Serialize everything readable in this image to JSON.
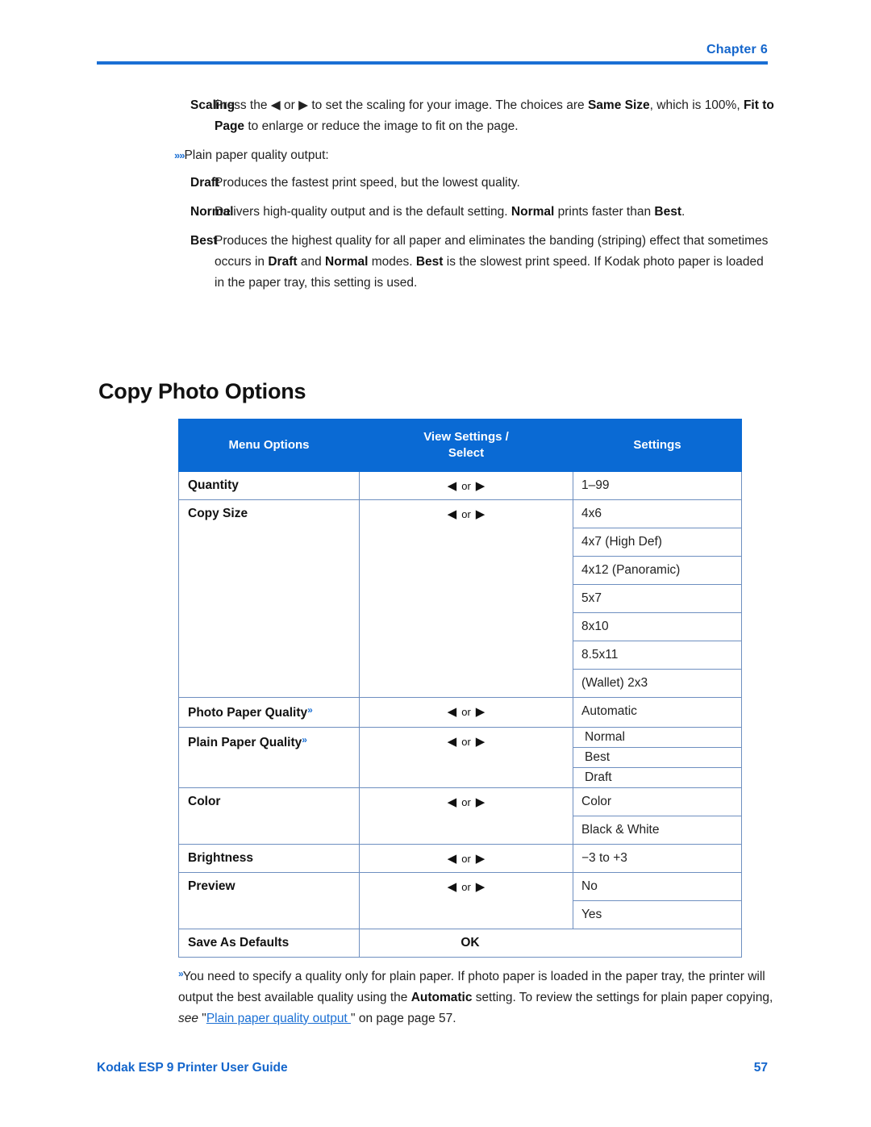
{
  "header": {
    "chapter_label": "Chapter",
    "chapter_number": "6"
  },
  "definitions": [
    {
      "term": "Scaling",
      "desc_parts": [
        {
          "t": "Press the ",
          "b": false
        },
        {
          "t": "◀",
          "b": false
        },
        {
          "t": " or ",
          "b": false
        },
        {
          "t": "▶",
          "b": false
        },
        {
          "t": " to set the scaling for your image. The choices are ",
          "b": false
        },
        {
          "t": "Same Size",
          "b": true
        },
        {
          "t": ", which is 100%, ",
          "b": false
        },
        {
          "t": "Fit to Page",
          "b": true
        },
        {
          "t": " to enlarge or reduce the image to fit on the page.",
          "b": false
        }
      ]
    }
  ],
  "bullet": {
    "marker": "»»",
    "text": "Plain paper quality output:"
  },
  "quality_defs": [
    {
      "term": "Draft",
      "desc_parts": [
        {
          "t": "Produces the fastest print speed, but the lowest quality.",
          "b": false
        }
      ]
    },
    {
      "term": "Normal",
      "desc_parts": [
        {
          "t": "Delivers high-quality output and is the default setting. ",
          "b": false
        },
        {
          "t": "Normal",
          "b": true
        },
        {
          "t": " prints faster than ",
          "b": false
        },
        {
          "t": "Best",
          "b": true
        },
        {
          "t": ".",
          "b": false
        }
      ]
    },
    {
      "term": "Best",
      "desc_parts": [
        {
          "t": "Produces the highest quality for all paper and eliminates the banding (striping) effect that sometimes occurs in ",
          "b": false
        },
        {
          "t": "Draft",
          "b": true
        },
        {
          "t": " and ",
          "b": false
        },
        {
          "t": "Normal",
          "b": true
        },
        {
          "t": " modes. ",
          "b": false
        },
        {
          "t": "Best",
          "b": true
        },
        {
          "t": " is the slowest print speed. If Kodak photo paper is loaded in the paper tray, this setting is used.",
          "b": false
        }
      ]
    }
  ],
  "section": {
    "heading": "Copy Photo Options"
  },
  "table": {
    "columns": [
      "Menu Options",
      "View Settings /\nSelect",
      "Settings"
    ],
    "column_headers": {
      "col1": "Menu Options",
      "col2_line1": "View Settings /",
      "col2_line2": "Select",
      "col3": "Settings"
    },
    "arrow_left": "◀",
    "arrow_right": "▶",
    "or_word": "or",
    "rows": [
      {
        "menu": "Quantity",
        "marker": "",
        "select": "arrows",
        "settings": [
          "1–99"
        ]
      },
      {
        "menu": "Copy Size",
        "marker": "",
        "select": "arrows",
        "settings": [
          "4x6",
          "4x7 (High Def)",
          "4x12 (Panoramic)",
          "5x7",
          "8x10",
          "8.5x11",
          "(Wallet) 2x3"
        ]
      },
      {
        "menu": "Photo Paper Quality",
        "marker": "»",
        "select": "arrows",
        "settings": [
          "Automatic"
        ]
      },
      {
        "menu": "Plain Paper Quality",
        "marker": "»",
        "select": "arrows",
        "settings": [
          "Normal",
          "Best",
          "Draft"
        ]
      },
      {
        "menu": "Color",
        "marker": "",
        "select": "arrows",
        "settings": [
          "Color",
          "Black & White"
        ]
      },
      {
        "menu": "Brightness",
        "marker": "",
        "select": "arrows",
        "settings": [
          "−3 to +3"
        ]
      },
      {
        "menu": "Preview",
        "marker": "",
        "select": "arrows",
        "settings": [
          "No",
          "Yes"
        ]
      },
      {
        "menu": "Save As Defaults",
        "marker": "",
        "select": "OK",
        "settings": []
      }
    ]
  },
  "footnote": {
    "marker": "»",
    "part1": "You need to specify a quality only for plain paper. If photo paper is loaded in the paper tray, the printer will output the best available quality using the ",
    "bold1": "Automatic",
    "part2": " setting. To review the  settings for plain paper copying, ",
    "italic1": "see",
    "part3": " \"",
    "link": "Plain paper quality output ",
    "part4": "\" on page page 57."
  },
  "footer": {
    "guide_title": "Kodak ESP 9 Printer User Guide",
    "page_number": "57"
  },
  "colors": {
    "brand_blue": "#1a6fd4",
    "header_blue": "#0a6ad4",
    "table_border": "#6e8fc0",
    "link_blue": "#1a6fd4"
  }
}
